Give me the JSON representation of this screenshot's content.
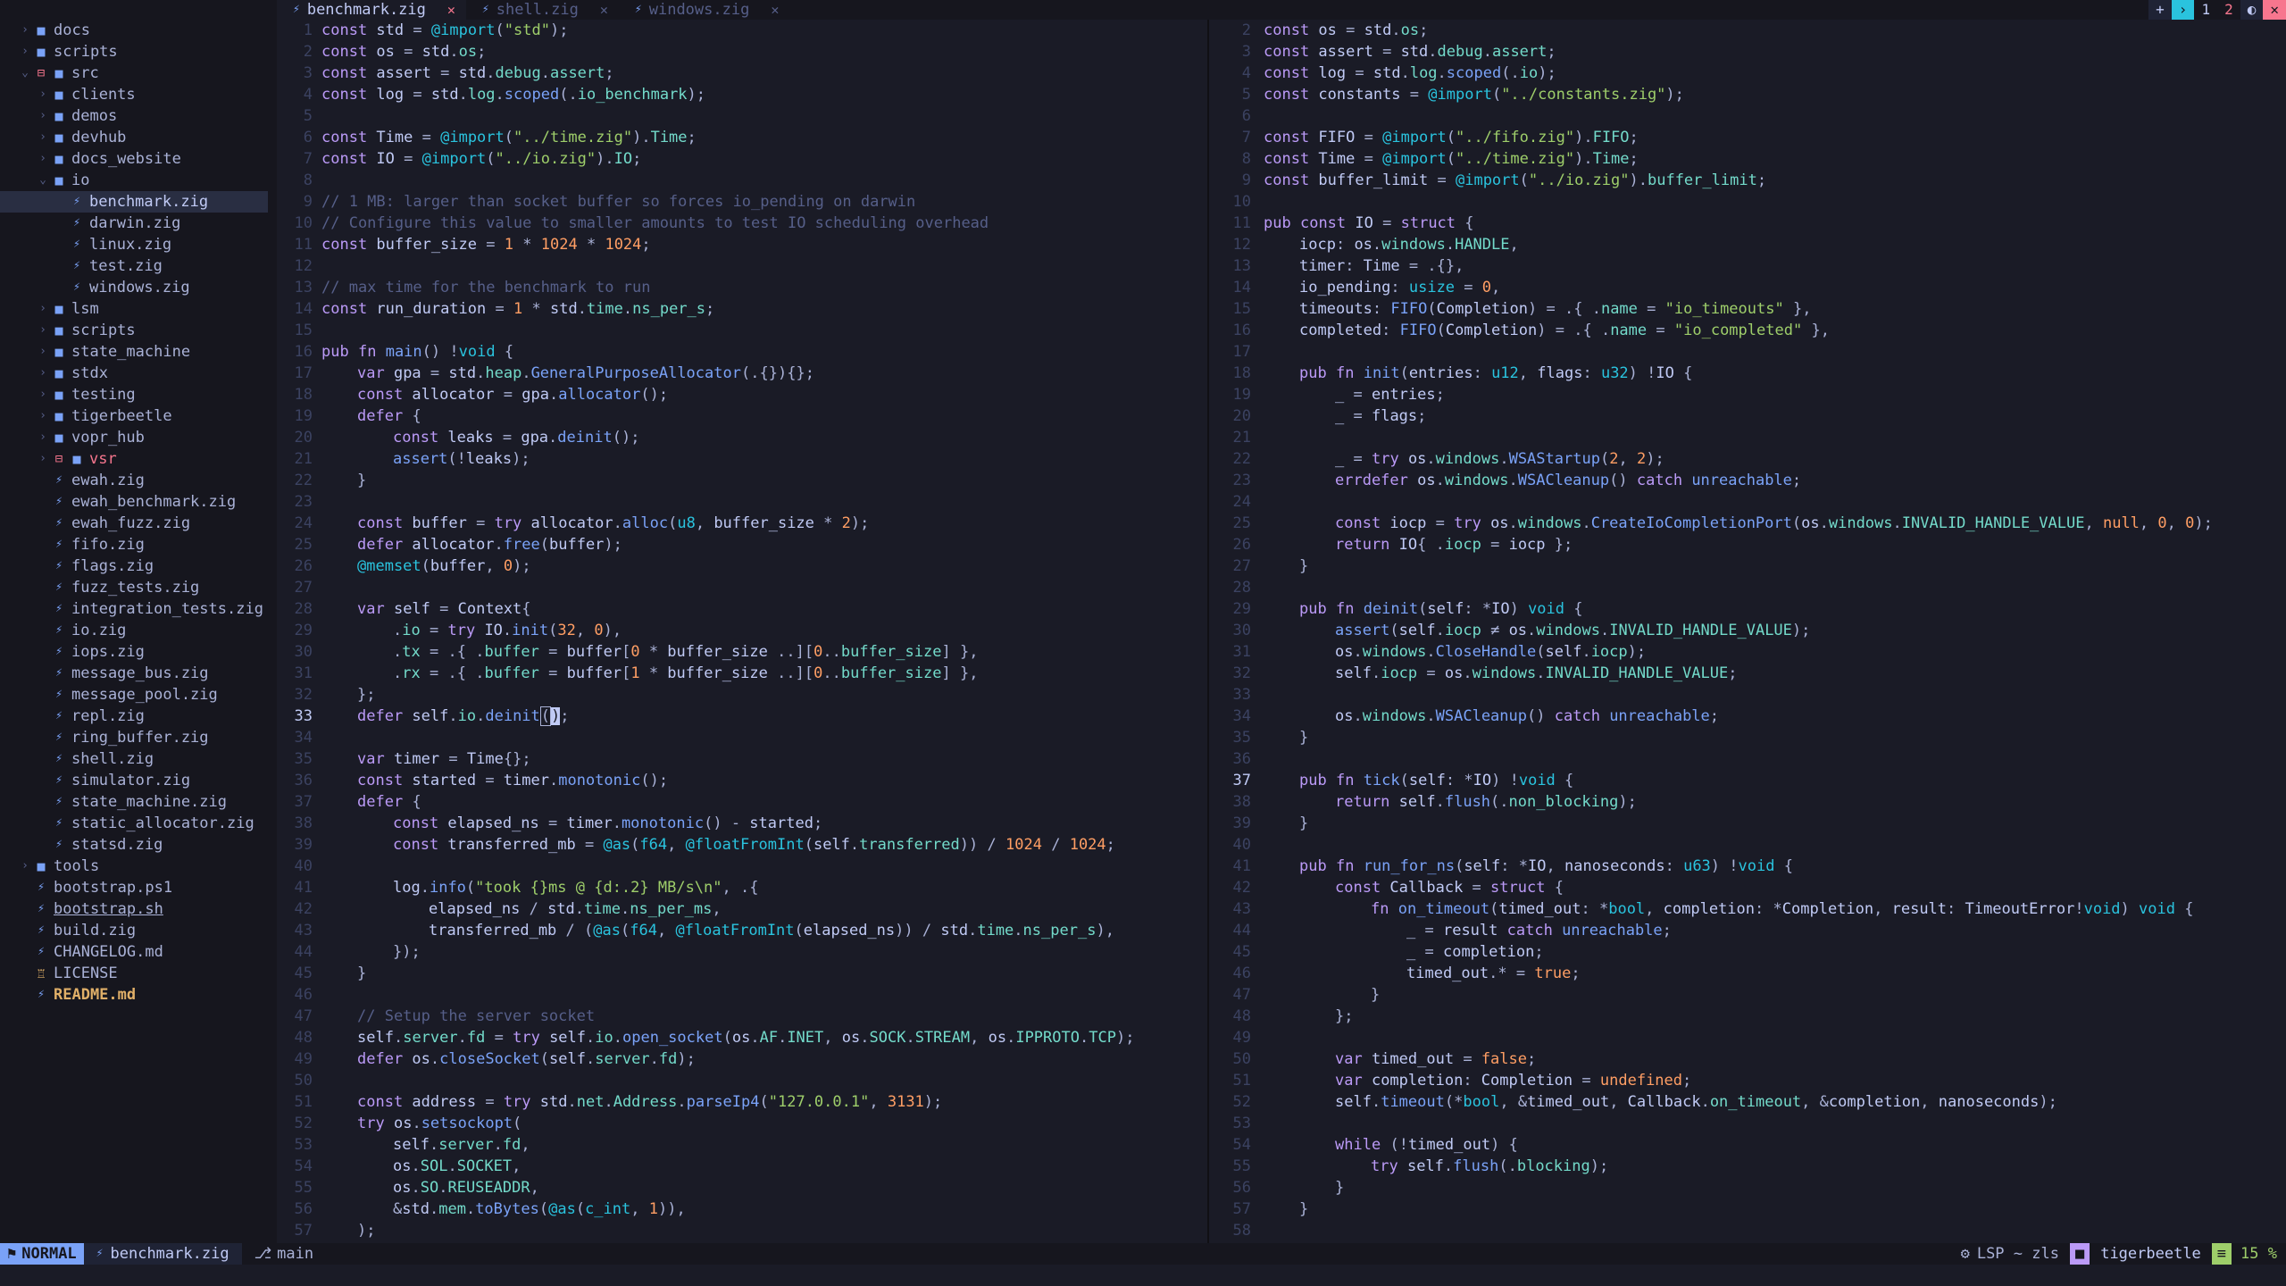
{
  "tabs": [
    {
      "label": "benchmark.zig",
      "active": true
    },
    {
      "label": "shell.zig",
      "active": false
    },
    {
      "label": "windows.zig",
      "active": false
    }
  ],
  "tabbar_right": {
    "plus": "+",
    "chevron": "›",
    "num1": "1",
    "num2": "2",
    "toggle": "◐",
    "close": "✕"
  },
  "tree": [
    {
      "depth": 0,
      "type": "dir",
      "name": "docs",
      "open": false
    },
    {
      "depth": 0,
      "type": "dir",
      "name": "scripts",
      "open": false
    },
    {
      "depth": 0,
      "type": "dir",
      "name": "src",
      "open": true,
      "git": true
    },
    {
      "depth": 1,
      "type": "dir",
      "name": "clients",
      "open": false
    },
    {
      "depth": 1,
      "type": "dir",
      "name": "demos",
      "open": false
    },
    {
      "depth": 1,
      "type": "dir",
      "name": "devhub",
      "open": false
    },
    {
      "depth": 1,
      "type": "dir",
      "name": "docs_website",
      "open": false
    },
    {
      "depth": 1,
      "type": "dir",
      "name": "io",
      "open": true
    },
    {
      "depth": 2,
      "type": "file",
      "name": "benchmark.zig",
      "selected": true
    },
    {
      "depth": 2,
      "type": "file",
      "name": "darwin.zig"
    },
    {
      "depth": 2,
      "type": "file",
      "name": "linux.zig"
    },
    {
      "depth": 2,
      "type": "file",
      "name": "test.zig"
    },
    {
      "depth": 2,
      "type": "file",
      "name": "windows.zig"
    },
    {
      "depth": 1,
      "type": "dir",
      "name": "lsm",
      "open": false
    },
    {
      "depth": 1,
      "type": "dir",
      "name": "scripts",
      "open": false
    },
    {
      "depth": 1,
      "type": "dir",
      "name": "state_machine",
      "open": false
    },
    {
      "depth": 1,
      "type": "dir",
      "name": "stdx",
      "open": false
    },
    {
      "depth": 1,
      "type": "dir",
      "name": "testing",
      "open": false
    },
    {
      "depth": 1,
      "type": "dir",
      "name": "tigerbeetle",
      "open": false
    },
    {
      "depth": 1,
      "type": "dir",
      "name": "vopr_hub",
      "open": false
    },
    {
      "depth": 1,
      "type": "dir",
      "name": "vsr",
      "open": false,
      "git": true,
      "red": true
    },
    {
      "depth": 1,
      "type": "file",
      "name": "ewah.zig"
    },
    {
      "depth": 1,
      "type": "file",
      "name": "ewah_benchmark.zig"
    },
    {
      "depth": 1,
      "type": "file",
      "name": "ewah_fuzz.zig"
    },
    {
      "depth": 1,
      "type": "file",
      "name": "fifo.zig"
    },
    {
      "depth": 1,
      "type": "file",
      "name": "flags.zig"
    },
    {
      "depth": 1,
      "type": "file",
      "name": "fuzz_tests.zig"
    },
    {
      "depth": 1,
      "type": "file",
      "name": "integration_tests.zig"
    },
    {
      "depth": 1,
      "type": "file",
      "name": "io.zig"
    },
    {
      "depth": 1,
      "type": "file",
      "name": "iops.zig"
    },
    {
      "depth": 1,
      "type": "file",
      "name": "message_bus.zig"
    },
    {
      "depth": 1,
      "type": "file",
      "name": "message_pool.zig"
    },
    {
      "depth": 1,
      "type": "file",
      "name": "repl.zig"
    },
    {
      "depth": 1,
      "type": "file",
      "name": "ring_buffer.zig"
    },
    {
      "depth": 1,
      "type": "file",
      "name": "shell.zig"
    },
    {
      "depth": 1,
      "type": "file",
      "name": "simulator.zig"
    },
    {
      "depth": 1,
      "type": "file",
      "name": "state_machine.zig"
    },
    {
      "depth": 1,
      "type": "file",
      "name": "static_allocator.zig"
    },
    {
      "depth": 1,
      "type": "file",
      "name": "statsd.zig"
    },
    {
      "depth": 0,
      "type": "dir",
      "name": "tools",
      "open": false
    },
    {
      "depth": 0,
      "type": "file",
      "name": "bootstrap.ps1"
    },
    {
      "depth": 0,
      "type": "file",
      "name": "bootstrap.sh",
      "underline": true
    },
    {
      "depth": 0,
      "type": "file",
      "name": "build.zig"
    },
    {
      "depth": 0,
      "type": "file",
      "name": "CHANGELOG.md"
    },
    {
      "depth": 0,
      "type": "license",
      "name": "LICENSE"
    },
    {
      "depth": 0,
      "type": "file",
      "name": "README.md",
      "bold": true
    }
  ],
  "left_pane": {
    "current_line": 33,
    "lines": [
      [
        1,
        0,
        "const std = @import(\"std\");"
      ],
      [
        2,
        0,
        "const os = std.os;"
      ],
      [
        3,
        0,
        "const assert = std.debug.assert;"
      ],
      [
        4,
        0,
        "const log = std.log.scoped(.io_benchmark);"
      ],
      [
        5,
        0,
        ""
      ],
      [
        6,
        0,
        "const Time = @import(\"../time.zig\").Time;"
      ],
      [
        7,
        0,
        "const IO = @import(\"../io.zig\").IO;"
      ],
      [
        8,
        0,
        ""
      ],
      [
        9,
        0,
        "// 1 MB: larger than socket buffer so forces io_pending on darwin"
      ],
      [
        10,
        0,
        "// Configure this value to smaller amounts to test IO scheduling overhead"
      ],
      [
        11,
        0,
        "const buffer_size = 1 * 1024 * 1024;"
      ],
      [
        12,
        0,
        ""
      ],
      [
        13,
        0,
        "// max time for the benchmark to run"
      ],
      [
        14,
        0,
        "const run_duration = 1 * std.time.ns_per_s;"
      ],
      [
        15,
        0,
        ""
      ],
      [
        16,
        0,
        "pub fn main() !void {"
      ],
      [
        17,
        1,
        "var gpa = std.heap.GeneralPurposeAllocator(.{}){};"
      ],
      [
        18,
        1,
        "const allocator = gpa.allocator();"
      ],
      [
        19,
        1,
        "defer {"
      ],
      [
        20,
        2,
        "const leaks = gpa.deinit();"
      ],
      [
        21,
        2,
        "assert(!leaks);"
      ],
      [
        22,
        1,
        "}"
      ],
      [
        23,
        0,
        ""
      ],
      [
        24,
        1,
        "const buffer = try allocator.alloc(u8, buffer_size * 2);"
      ],
      [
        25,
        1,
        "defer allocator.free(buffer);"
      ],
      [
        26,
        1,
        "@memset(buffer, 0);"
      ],
      [
        27,
        0,
        ""
      ],
      [
        28,
        1,
        "var self = Context{"
      ],
      [
        29,
        2,
        ".io = try IO.init(32, 0),"
      ],
      [
        30,
        2,
        ".tx = .{ .buffer = buffer[0 * buffer_size ..][0..buffer_size] },"
      ],
      [
        31,
        2,
        ".rx = .{ .buffer = buffer[1 * buffer_size ..][0..buffer_size] },"
      ],
      [
        32,
        1,
        "};"
      ],
      [
        33,
        1,
        "defer self.io.deinit();"
      ],
      [
        34,
        0,
        ""
      ],
      [
        35,
        1,
        "var timer = Time{};"
      ],
      [
        36,
        1,
        "const started = timer.monotonic();"
      ],
      [
        37,
        1,
        "defer {"
      ],
      [
        38,
        2,
        "const elapsed_ns = timer.monotonic() - started;"
      ],
      [
        39,
        2,
        "const transferred_mb = @as(f64, @floatFromInt(self.transferred)) / 1024 / 1024;"
      ],
      [
        40,
        0,
        ""
      ],
      [
        41,
        2,
        "log.info(\"took {}ms @ {d:.2} MB/s\\n\", .{"
      ],
      [
        42,
        3,
        "elapsed_ns / std.time.ns_per_ms,"
      ],
      [
        43,
        3,
        "transferred_mb / (@as(f64, @floatFromInt(elapsed_ns)) / std.time.ns_per_s),"
      ],
      [
        44,
        2,
        "});"
      ],
      [
        45,
        1,
        "}"
      ],
      [
        46,
        0,
        ""
      ],
      [
        47,
        1,
        "// Setup the server socket"
      ],
      [
        48,
        1,
        "self.server.fd = try self.io.open_socket(os.AF.INET, os.SOCK.STREAM, os.IPPROTO.TCP);"
      ],
      [
        49,
        1,
        "defer os.closeSocket(self.server.fd);"
      ],
      [
        50,
        0,
        ""
      ],
      [
        51,
        1,
        "const address = try std.net.Address.parseIp4(\"127.0.0.1\", 3131);"
      ],
      [
        52,
        1,
        "try os.setsockopt("
      ],
      [
        53,
        2,
        "self.server.fd,"
      ],
      [
        54,
        2,
        "os.SOL.SOCKET,"
      ],
      [
        55,
        2,
        "os.SO.REUSEADDR,"
      ],
      [
        56,
        2,
        "&std.mem.toBytes(@as(c_int, 1)),"
      ],
      [
        57,
        1,
        ");"
      ]
    ]
  },
  "right_pane": {
    "current_line": 37,
    "lines": [
      [
        2,
        0,
        "const os = std.os;"
      ],
      [
        3,
        0,
        "const assert = std.debug.assert;"
      ],
      [
        4,
        0,
        "const log = std.log.scoped(.io);"
      ],
      [
        5,
        0,
        "const constants = @import(\"../constants.zig\");"
      ],
      [
        6,
        0,
        ""
      ],
      [
        7,
        0,
        "const FIFO = @import(\"../fifo.zig\").FIFO;"
      ],
      [
        8,
        0,
        "const Time = @import(\"../time.zig\").Time;"
      ],
      [
        9,
        0,
        "const buffer_limit = @import(\"../io.zig\").buffer_limit;"
      ],
      [
        10,
        0,
        ""
      ],
      [
        11,
        0,
        "pub const IO = struct {"
      ],
      [
        12,
        1,
        "iocp: os.windows.HANDLE,"
      ],
      [
        13,
        1,
        "timer: Time = .{},"
      ],
      [
        14,
        1,
        "io_pending: usize = 0,"
      ],
      [
        15,
        1,
        "timeouts: FIFO(Completion) = .{ .name = \"io_timeouts\" },"
      ],
      [
        16,
        1,
        "completed: FIFO(Completion) = .{ .name = \"io_completed\" },"
      ],
      [
        17,
        0,
        ""
      ],
      [
        18,
        1,
        "pub fn init(entries: u12, flags: u32) !IO {"
      ],
      [
        19,
        2,
        "_ = entries;"
      ],
      [
        20,
        2,
        "_ = flags;"
      ],
      [
        21,
        0,
        ""
      ],
      [
        22,
        2,
        "_ = try os.windows.WSAStartup(2, 2);"
      ],
      [
        23,
        2,
        "errdefer os.windows.WSACleanup() catch unreachable;"
      ],
      [
        24,
        0,
        ""
      ],
      [
        25,
        2,
        "const iocp = try os.windows.CreateIoCompletionPort(os.windows.INVALID_HANDLE_VALUE, null, 0, 0);"
      ],
      [
        26,
        2,
        "return IO{ .iocp = iocp };"
      ],
      [
        27,
        1,
        "}"
      ],
      [
        28,
        0,
        ""
      ],
      [
        29,
        1,
        "pub fn deinit(self: *IO) void {"
      ],
      [
        30,
        2,
        "assert(self.iocp ≠ os.windows.INVALID_HANDLE_VALUE);"
      ],
      [
        31,
        2,
        "os.windows.CloseHandle(self.iocp);"
      ],
      [
        32,
        2,
        "self.iocp = os.windows.INVALID_HANDLE_VALUE;"
      ],
      [
        33,
        0,
        ""
      ],
      [
        34,
        2,
        "os.windows.WSACleanup() catch unreachable;"
      ],
      [
        35,
        1,
        "}"
      ],
      [
        36,
        0,
        ""
      ],
      [
        37,
        1,
        "pub fn tick(self: *IO) !void {"
      ],
      [
        38,
        2,
        "return self.flush(.non_blocking);"
      ],
      [
        39,
        1,
        "}"
      ],
      [
        40,
        0,
        ""
      ],
      [
        41,
        1,
        "pub fn run_for_ns(self: *IO, nanoseconds: u63) !void {"
      ],
      [
        42,
        2,
        "const Callback = struct {"
      ],
      [
        43,
        3,
        "fn on_timeout(timed_out: *bool, completion: *Completion, result: TimeoutError!void) void {"
      ],
      [
        44,
        4,
        "_ = result catch unreachable;"
      ],
      [
        45,
        4,
        "_ = completion;"
      ],
      [
        46,
        4,
        "timed_out.* = true;"
      ],
      [
        47,
        3,
        "}"
      ],
      [
        48,
        2,
        "};"
      ],
      [
        49,
        0,
        ""
      ],
      [
        50,
        2,
        "var timed_out = false;"
      ],
      [
        51,
        2,
        "var completion: Completion = undefined;"
      ],
      [
        52,
        2,
        "self.timeout(*bool, &timed_out, Callback.on_timeout, &completion, nanoseconds);"
      ],
      [
        53,
        0,
        ""
      ],
      [
        54,
        2,
        "while (!timed_out) {"
      ],
      [
        55,
        3,
        "try self.flush(.blocking);"
      ],
      [
        56,
        2,
        "}"
      ],
      [
        57,
        1,
        "}"
      ],
      [
        58,
        0,
        ""
      ]
    ]
  },
  "statusline": {
    "mode": "NORMAL",
    "file": "benchmark.zig",
    "branch": "main",
    "lsp": "LSP ~ zls",
    "project": "tigerbeetle",
    "position": "15 %"
  }
}
